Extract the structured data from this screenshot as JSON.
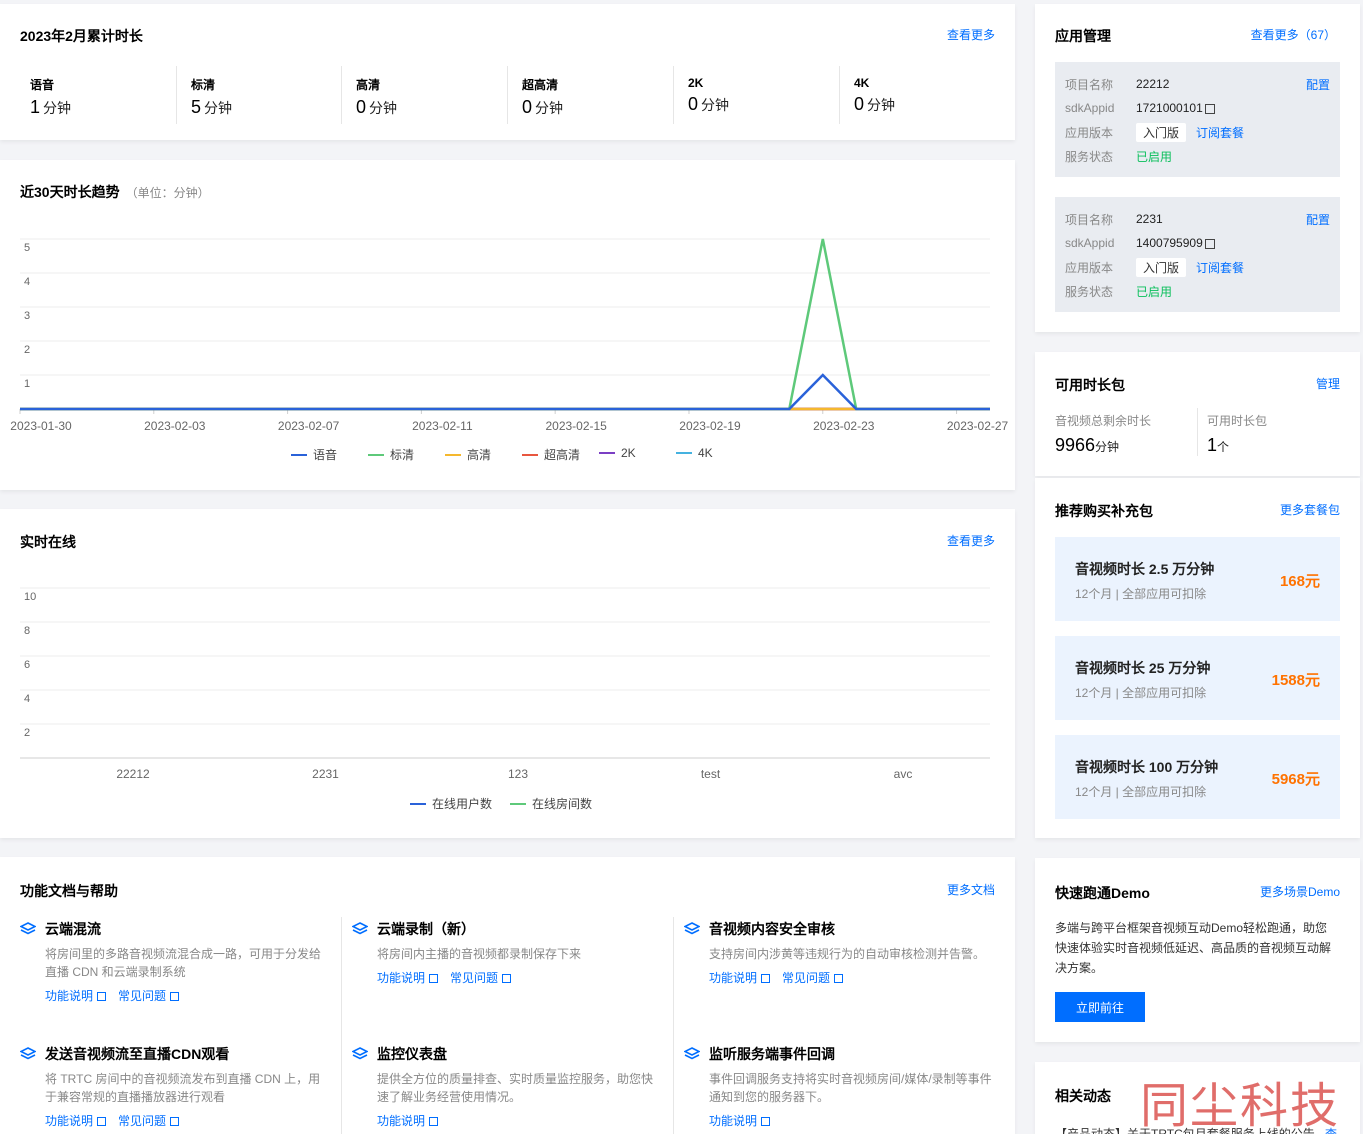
{
  "monthly": {
    "title": "2023年2月累计时长",
    "more": "查看更多",
    "unit": "分钟",
    "stats": [
      {
        "label": "语音",
        "value": "1"
      },
      {
        "label": "标清",
        "value": "5"
      },
      {
        "label": "高清",
        "value": "0"
      },
      {
        "label": "超高清",
        "value": "0"
      },
      {
        "label": "2K",
        "value": "0"
      },
      {
        "label": "4K",
        "value": "0"
      }
    ]
  },
  "trend": {
    "title": "近30天时长趋势",
    "unit_note": "（单位：分钟）"
  },
  "realtime": {
    "title": "实时在线",
    "more": "查看更多"
  },
  "chart_data": [
    {
      "type": "line",
      "title": "近30天时长趋势",
      "x_ticks": [
        "2023-01-30",
        "2023-02-03",
        "2023-02-07",
        "2023-02-11",
        "2023-02-15",
        "2023-02-19",
        "2023-02-23",
        "2023-02-27"
      ],
      "x_range": [
        "2023-01-30",
        "2023-02-28"
      ],
      "y_ticks": [
        1,
        2,
        3,
        4,
        5
      ],
      "ylim": [
        0,
        5
      ],
      "grid": true,
      "legend_position": "bottom",
      "series": [
        {
          "name": "语音",
          "color": "#2a62d9",
          "points": [
            [
              "2023-01-30",
              0
            ],
            [
              "2023-02-22",
              0
            ],
            [
              "2023-02-23",
              1
            ],
            [
              "2023-02-24",
              0
            ],
            [
              "2023-02-28",
              0
            ]
          ]
        },
        {
          "name": "标清",
          "color": "#5ec97a",
          "points": [
            [
              "2023-01-30",
              0
            ],
            [
              "2023-02-22",
              0
            ],
            [
              "2023-02-23",
              5
            ],
            [
              "2023-02-24",
              0
            ],
            [
              "2023-02-28",
              0
            ]
          ]
        },
        {
          "name": "高清",
          "color": "#f5b82e",
          "points": [
            [
              "2023-01-30",
              0
            ],
            [
              "2023-02-28",
              0
            ]
          ]
        },
        {
          "name": "超高清",
          "color": "#e8563f",
          "points": [
            [
              "2023-01-30",
              0
            ],
            [
              "2023-02-28",
              0
            ]
          ]
        },
        {
          "name": "2K",
          "color": "#7b3fc4",
          "points": [
            [
              "2023-01-30",
              0
            ],
            [
              "2023-02-28",
              0
            ]
          ]
        },
        {
          "name": "4K",
          "color": "#45b2e0",
          "points": [
            [
              "2023-01-30",
              0
            ],
            [
              "2023-02-28",
              0
            ]
          ]
        }
      ]
    },
    {
      "type": "bar",
      "title": "实时在线",
      "categories": [
        "22212",
        "2231",
        "123",
        "test",
        "avc"
      ],
      "y_ticks": [
        2,
        4,
        6,
        8,
        10
      ],
      "ylim": [
        0,
        10
      ],
      "grid": true,
      "legend_position": "bottom",
      "series": [
        {
          "name": "在线用户数",
          "color": "#2a62d9",
          "values": [
            0,
            0,
            0,
            0,
            0
          ]
        },
        {
          "name": "在线房间数",
          "color": "#5ec97a",
          "values": [
            0,
            0,
            0,
            0,
            0
          ]
        }
      ]
    }
  ],
  "apps": {
    "title": "应用管理",
    "more": "查看更多（67）",
    "items": [
      {
        "name_k": "项目名称",
        "name": "22212",
        "config": "配置",
        "sdk_k": "sdkAppid",
        "sdk": "1721000101",
        "ver_k": "应用版本",
        "ver": "入门版",
        "sub": "订阅套餐",
        "status_k": "服务状态",
        "status": "已启用"
      },
      {
        "name_k": "项目名称",
        "name": "2231",
        "config": "配置",
        "sdk_k": "sdkAppid",
        "sdk": "1400795909",
        "ver_k": "应用版本",
        "ver": "入门版",
        "sub": "订阅套餐",
        "status_k": "服务状态",
        "status": "已启用"
      }
    ]
  },
  "packs": {
    "title": "可用时长包",
    "manage": "管理",
    "remain_label": "音视频总剩余时长",
    "remain_value": "9966",
    "remain_unit": "分钟",
    "avail_label": "可用时长包",
    "avail_value": "1",
    "avail_unit": "个"
  },
  "recommend": {
    "title": "推荐购买补充包",
    "more": "更多套餐包",
    "items": [
      {
        "name": "音视频时长 2.5 万分钟",
        "desc": "12个月 | 全部应用可扣除",
        "price": "168元"
      },
      {
        "name": "音视频时长 25 万分钟",
        "desc": "12个月 | 全部应用可扣除",
        "price": "1588元"
      },
      {
        "name": "音视频时长 100 万分钟",
        "desc": "12个月 | 全部应用可扣除",
        "price": "5968元"
      }
    ]
  },
  "docs": {
    "title": "功能文档与帮助",
    "more": "更多文档",
    "items": [
      {
        "title": "云端混流",
        "desc": "将房间里的多路音视频流混合成一路，可用于分发给直播 CDN 和云端录制系统",
        "l1": "功能说明",
        "l2": "常见问题"
      },
      {
        "title": "云端录制（新）",
        "desc": "将房间内主播的音视频都录制保存下来",
        "l1": "功能说明",
        "l2": "常见问题"
      },
      {
        "title": "音视频内容安全审核",
        "desc": "支持房间内涉黄等违规行为的自动审核检测并告警。",
        "l1": "功能说明",
        "l2": "常见问题"
      },
      {
        "title": "发送音视频流至直播CDN观看",
        "desc": "将 TRTC 房间中的音视频流发布到直播 CDN 上，用于兼容常规的直播播放器进行观看",
        "l1": "功能说明",
        "l2": "常见问题"
      },
      {
        "title": "监控仪表盘",
        "desc": "提供全方位的质量排查、实时质量监控服务，助您快速了解业务经营使用情况。",
        "l1": "功能说明"
      },
      {
        "title": "监听服务端事件回调",
        "desc": "事件回调服务支持将实时音视频房间/媒体/录制等事件通知到您的服务器下。",
        "l1": "功能说明"
      }
    ]
  },
  "demo": {
    "title": "快速跑通Demo",
    "more": "更多场景Demo",
    "desc": "多端与跨平台框架音视频互动Demo轻松跑通，助您快速体验实时音视频低延迟、高品质的音视频互动解决方案。",
    "button": "立即前往"
  },
  "news": {
    "title": "相关动态",
    "line": "【产品动态】关于TRTC包月套餐服务上线的公告",
    "more": "查"
  },
  "watermark": "同尘科技"
}
